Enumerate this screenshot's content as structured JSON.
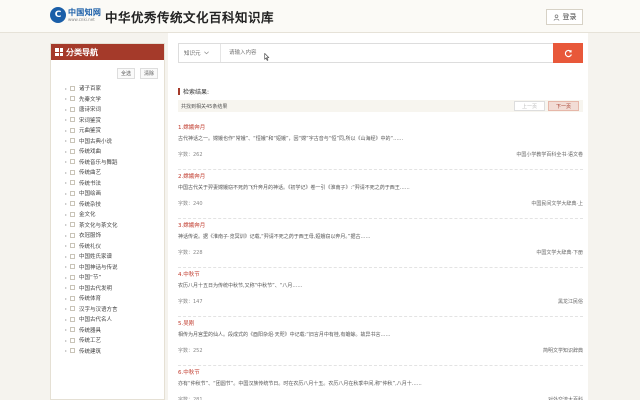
{
  "header": {
    "logo_brand": "中国知网",
    "logo_url": "www.cnki.net",
    "site_title": "中华优秀传统文化百科知识库",
    "login_label": "登录"
  },
  "sidebar": {
    "title": "分类导航",
    "select_all": "全选",
    "clear": "清除",
    "categories": [
      "诸子百家",
      "先秦文学",
      "唐诗宋词",
      "宋词鉴赏",
      "元曲鉴赏",
      "中国古典小说",
      "传统戏曲",
      "传统音乐与舞蹈",
      "传统曲艺",
      "传统书法",
      "中国绘画",
      "传统杂技",
      "金文化",
      "茶文化与茶文化",
      "衣冠服饰",
      "传统礼仪",
      "中国姓氏家谱",
      "中国神话与传说",
      "中国“节”",
      "中国古代发明",
      "传统体育",
      "汉字与汉语方言",
      "中国古代名人",
      "传统器具",
      "传统工艺",
      "传统建筑"
    ]
  },
  "search": {
    "field_option": "知识元",
    "placeholder": "请输入内容"
  },
  "results": {
    "heading": "检索结果:",
    "summary": "共找到相关45条结果",
    "prev_label": "上一页",
    "next_label": "下一页",
    "items": [
      {
        "title": "1.嫦娥奔月",
        "snippet": "古代神话之一。嫦娥也作“常娥”、“恒娥”和“姮娥”，因“嫦”字古音与“恒”同,所以《山海经》中的“……",
        "count": "字数：262",
        "source": "中国小学教学百科全书·语文卷"
      },
      {
        "title": "2.嫦娥奔月",
        "snippet": "中国古代关于羿妻嫦娥窃不死药飞升奔月的神话。《初学记》卷一引《淮南子》:“羿请不死之药于西王……",
        "count": "字数：240",
        "source": "中国民间文学大辞典·上"
      },
      {
        "title": "3.嫦娥奔月",
        "snippet": "神话传说。据《淮南子·览冥训》记载,“羿请不死之药于西王母,姮娥窃以奔月。”据古……",
        "count": "字数：228",
        "source": "中国文学大辞典·下册"
      },
      {
        "title": "4.中秋节",
        "snippet": "农历八月十五日为传统中秋节,又称“中秋节”、“八月……",
        "count": "字数：147",
        "source": "黑龙江民俗"
      },
      {
        "title": "5.吴刚",
        "snippet": "相传为月宫里的仙人。段成式的《酉阳杂俎·天咫》中记载:“旧言月中有桂,有蟾蜍。故异书言……",
        "count": "字数：252",
        "source": "简明文学知识辞典"
      },
      {
        "title": "6.中秋节",
        "snippet": "亦有“仲秋节”、“团圆节”。中国汉族传统节日。时在农历八月十五。农历八月在秋季中间,称“仲秋”,八月十……",
        "count": "字数：281",
        "source": "对外交流大百科"
      }
    ]
  }
}
